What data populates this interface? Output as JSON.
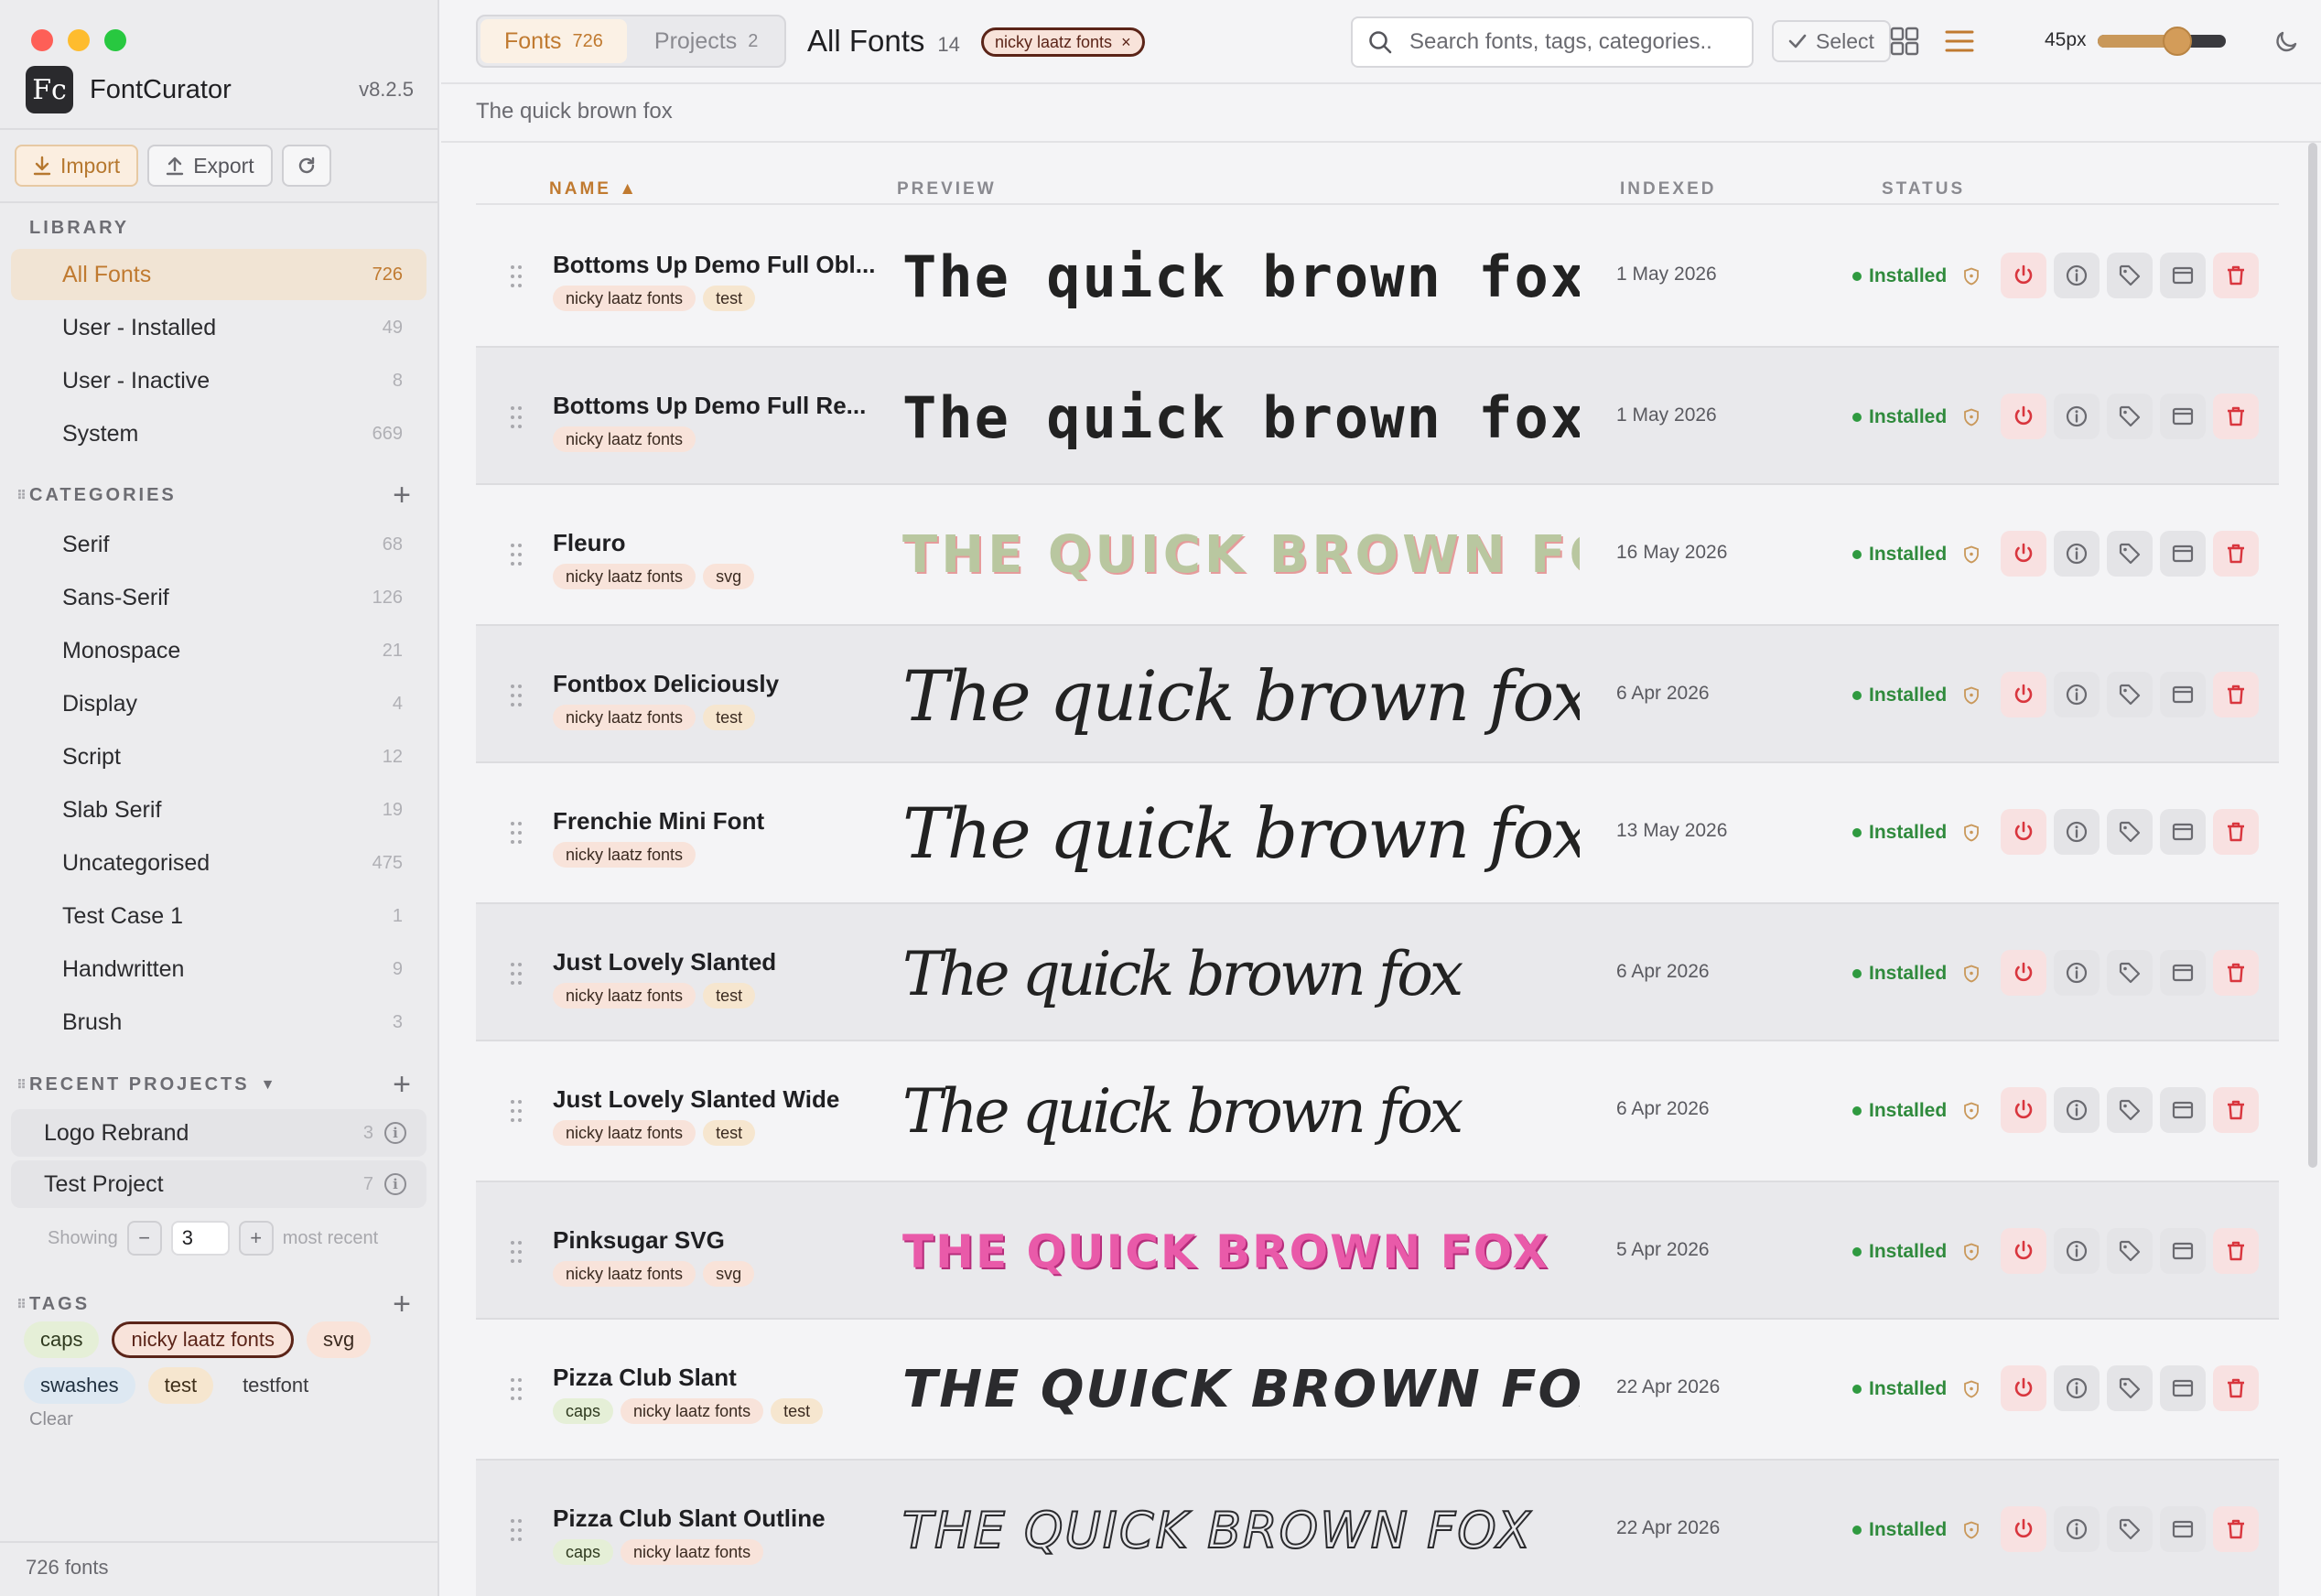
{
  "app": {
    "name": "FontCurator",
    "version": "v8.2.5",
    "logo": "Fc"
  },
  "toolbar": {
    "import_label": "Import",
    "export_label": "Export"
  },
  "sidebar": {
    "library_header": "LIBRARY",
    "library": [
      {
        "label": "All Fonts",
        "count": "726",
        "active": true
      },
      {
        "label": "User - Installed",
        "count": "49"
      },
      {
        "label": "User - Inactive",
        "count": "8"
      },
      {
        "label": "System",
        "count": "669"
      }
    ],
    "categories_header": "CATEGORIES",
    "categories": [
      {
        "label": "Serif",
        "count": "68"
      },
      {
        "label": "Sans-Serif",
        "count": "126"
      },
      {
        "label": "Monospace",
        "count": "21"
      },
      {
        "label": "Display",
        "count": "4"
      },
      {
        "label": "Script",
        "count": "12"
      },
      {
        "label": "Slab Serif",
        "count": "19"
      },
      {
        "label": "Uncategorised",
        "count": "475"
      },
      {
        "label": "Test Case 1",
        "count": "1"
      },
      {
        "label": "Handwritten",
        "count": "9"
      },
      {
        "label": "Brush",
        "count": "3"
      }
    ],
    "projects_header": "RECENT PROJECTS",
    "projects": [
      {
        "label": "Logo Rebrand",
        "count": "3"
      },
      {
        "label": "Test Project",
        "count": "7"
      }
    ],
    "showing": {
      "prefix": "Showing",
      "value": "3",
      "suffix": "most recent"
    },
    "tags_header": "TAGS",
    "tags": [
      {
        "label": "caps",
        "style": "caps"
      },
      {
        "label": "nicky laatz fonts",
        "style": "nicky"
      },
      {
        "label": "svg",
        "style": "svg"
      },
      {
        "label": "swashes",
        "style": "swashes"
      },
      {
        "label": "test",
        "style": "test"
      },
      {
        "label": "testfont",
        "style": "testfont"
      }
    ],
    "clear_label": "Clear",
    "footer": "726 fonts"
  },
  "topbar": {
    "tabs": [
      {
        "label": "Fonts",
        "count": "726",
        "active": true
      },
      {
        "label": "Projects",
        "count": "2"
      }
    ],
    "title": "All Fonts",
    "title_count": "14",
    "filter_chip": "nicky laatz fonts",
    "filter_chip_close": "×",
    "search_placeholder": "Search fonts, tags, categories...",
    "select_label": "Select",
    "size_label": "45px",
    "size_level": 0.62
  },
  "preview_text": "The quick brown fox",
  "table": {
    "headers": {
      "name": "NAME ▲",
      "preview": "PREVIEW",
      "indexed": "INDEXED",
      "status": "STATUS"
    },
    "rows": [
      {
        "name": "Bottoms Up Demo Full Obl...",
        "tags": [
          "nicky laatz fonts",
          "test"
        ],
        "preview": "The quick brown fox",
        "style": "p-bold",
        "date": "1 May 2026",
        "status": "Installed"
      },
      {
        "name": "Bottoms Up Demo Full Re...",
        "tags": [
          "nicky laatz fonts"
        ],
        "preview": "The quick brown fox",
        "style": "p-bold",
        "date": "1 May 2026",
        "status": "Installed"
      },
      {
        "name": "Fleuro",
        "tags": [
          "nicky laatz fonts",
          "svg"
        ],
        "preview": "THE QUICK BROWN FOX",
        "style": "p-caps-flower",
        "date": "16 May 2026",
        "status": "Installed"
      },
      {
        "name": "Fontbox Deliciously",
        "tags": [
          "nicky laatz fonts",
          "test"
        ],
        "preview": "The quick brown fox",
        "style": "p-script",
        "date": "6 Apr 2026",
        "status": "Installed"
      },
      {
        "name": "Frenchie Mini Font",
        "tags": [
          "nicky laatz fonts"
        ],
        "preview": "The quick brown fox",
        "style": "p-script",
        "date": "13 May 2026",
        "status": "Installed"
      },
      {
        "name": "Just Lovely Slanted",
        "tags": [
          "nicky laatz fonts",
          "test"
        ],
        "preview": "The quick brown fox",
        "style": "p-script-sm",
        "date": "6 Apr 2026",
        "status": "Installed"
      },
      {
        "name": "Just Lovely Slanted Wide",
        "tags": [
          "nicky laatz fonts",
          "test"
        ],
        "preview": "The quick brown fox",
        "style": "p-script-sm",
        "date": "6 Apr 2026",
        "status": "Installed"
      },
      {
        "name": "Pinksugar SVG",
        "tags": [
          "nicky laatz fonts",
          "svg"
        ],
        "preview": "THE QUICK BROWN FOX",
        "style": "p-caps-pink",
        "date": "5 Apr 2026",
        "status": "Installed"
      },
      {
        "name": "Pizza Club Slant",
        "tags": [
          "caps",
          "nicky laatz fonts",
          "test"
        ],
        "preview": "THE QUICK BROWN FOX",
        "style": "p-caps-italic",
        "date": "22 Apr 2026",
        "status": "Installed"
      },
      {
        "name": "Pizza Club Slant Outline",
        "tags": [
          "caps",
          "nicky laatz fonts"
        ],
        "preview": "THE QUICK BROWN FOX",
        "style": "p-caps-outline",
        "date": "22 Apr 2026",
        "status": "Installed"
      }
    ]
  },
  "colors": {
    "accent": "#c07a30",
    "installed": "#2f8a3c",
    "danger": "#d9363e"
  }
}
